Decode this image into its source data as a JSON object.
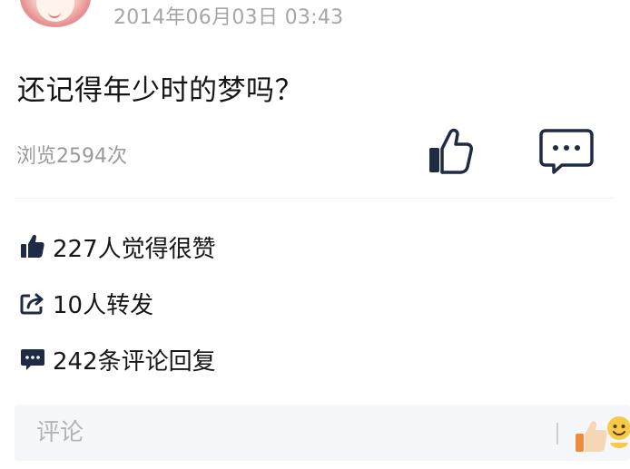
{
  "post": {
    "timestamp": "2014年06月03日 03:43",
    "title": "还记得年少时的梦吗？",
    "views": "浏览2594次"
  },
  "icons": {
    "avatar": "user-avatar",
    "like": "thumbs-up-icon",
    "comment": "comment-bubble-icon",
    "share": "share-icon",
    "emoji": "emoji-reaction-icon"
  },
  "stats": {
    "likes": "227人觉得很赞",
    "shares": "10人转发",
    "comments": "242条评论回复"
  },
  "comment_bar": {
    "placeholder": "评论"
  },
  "colors": {
    "accent_icon": "#1f2a44",
    "muted_text": "#9a9a9a",
    "input_bg": "#f6f7fb",
    "emoji_orange": "#f08a3c",
    "emoji_yellow": "#f7c948"
  }
}
